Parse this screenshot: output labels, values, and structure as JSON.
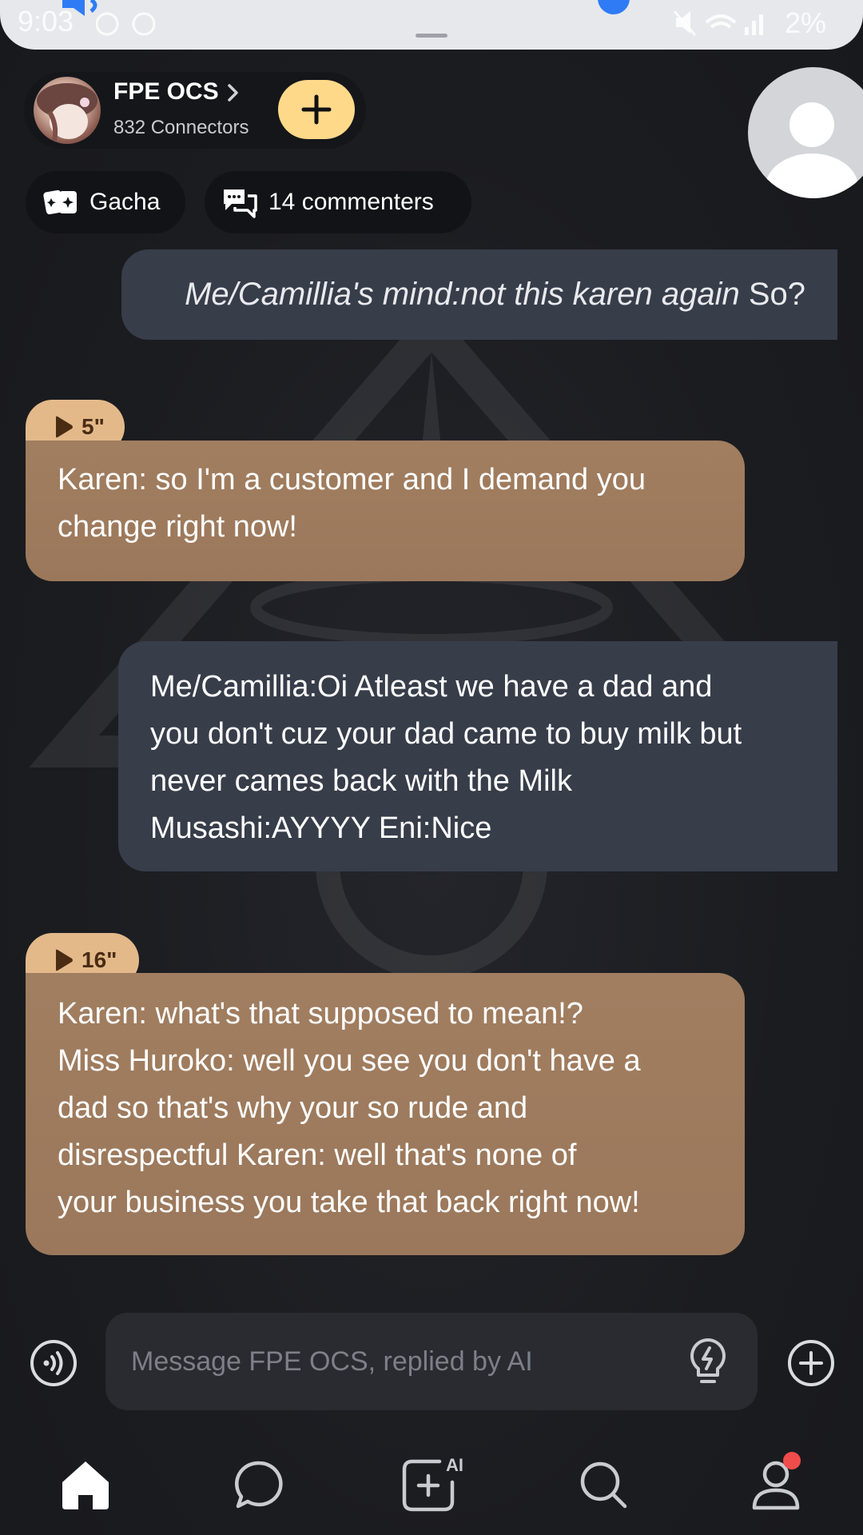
{
  "status_bar": {
    "time": "9:03",
    "battery": "2%"
  },
  "header": {
    "group_name": "FPE OCS",
    "connectors": "832 Connectors"
  },
  "chips": {
    "category": "Gacha",
    "commenters": "14 commenters"
  },
  "messages": [
    {
      "role": "user",
      "italic": "Me/Camillia's mind:not this karen again",
      "text": "So?"
    },
    {
      "role": "ai",
      "duration": "5\"",
      "text": "Karen: so I'm a customer and I demand you change right now!"
    },
    {
      "role": "user",
      "lines": [
        "Me/Camillia:Oi Atleast we have a dad and",
        "you don't cuz your dad came to buy milk but",
        "never cames back with the Milk",
        "Musashi:AYYYY Eni:Nice"
      ]
    },
    {
      "role": "ai",
      "duration": "16\"",
      "lines": [
        "Karen: what's that supposed to mean!?",
        "Miss Huroko: well you see you don't have a",
        "dad so that's why your so rude and",
        "disrespectful  Karen: well that's none of",
        "your business you take that back right now!"
      ]
    }
  ],
  "composer": {
    "placeholder": "Message FPE OCS, replied by AI"
  },
  "nav": {
    "create_badge": "AI",
    "items": [
      "home-icon",
      "chat-icon",
      "create-ai-icon",
      "search-icon",
      "profile-icon"
    ]
  },
  "colors": {
    "user_bubble": "#383d4a",
    "ai_bubble": "#9f7c5e",
    "badge": "#e3b98a",
    "join": "#ffd98a"
  }
}
